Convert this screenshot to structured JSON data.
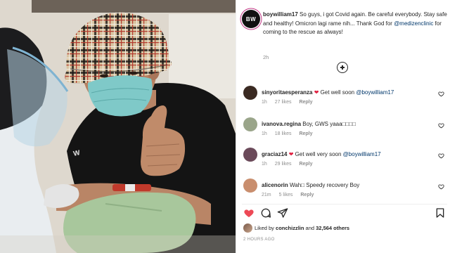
{
  "post": {
    "owner": {
      "username": "boywilliam17",
      "avatar_initials": "BW"
    },
    "caption": {
      "line1": "So guys, i got Covid again. Be careful everybody.",
      "line2": "Stay safe and healthy! Omicron lagi rame nih... Thank God for",
      "mention": "@medizenclinic",
      "line3_rest": " for coming to the rescue as always!"
    },
    "time_ago": "2h",
    "load_more_icon": "plus-circle-icon"
  },
  "comments": [
    {
      "username": "sinyoritaesperanza",
      "text": "Get well soon ",
      "mention": "@boywilliam17",
      "time": "1h",
      "likes": "27 likes",
      "reply": "Reply",
      "avatar_color": "#3a2a22"
    },
    {
      "username": "ivanova.regina",
      "text": "Boy, GWS yaaa□□□□",
      "mention": "",
      "time": "1h",
      "likes": "18 likes",
      "reply": "Reply",
      "avatar_color": "#9aa58a"
    },
    {
      "username": "graciaz14",
      "text": "Get well very soon ",
      "mention": "@boywilliam17",
      "time": "1h",
      "likes": "29 likes",
      "reply": "Reply",
      "avatar_color": "#6b4a5a"
    },
    {
      "username": "alicenorin",
      "text": "Wah□ Speedy recovery Boy",
      "mention": "",
      "time": "21m",
      "likes": "5 likes",
      "reply": "Reply",
      "avatar_color": "#c98e6e"
    }
  ],
  "actions": {
    "like_icon": "heart-filled-icon",
    "comment_icon": "comment-icon",
    "share_icon": "send-icon",
    "save_icon": "bookmark-icon",
    "like_color": "#ed4956"
  },
  "likes": {
    "prefix": "Liked by ",
    "user": "conchizzlin",
    "middle": " and ",
    "count": "32,564 others"
  },
  "posted": "2 HOURS AGO"
}
